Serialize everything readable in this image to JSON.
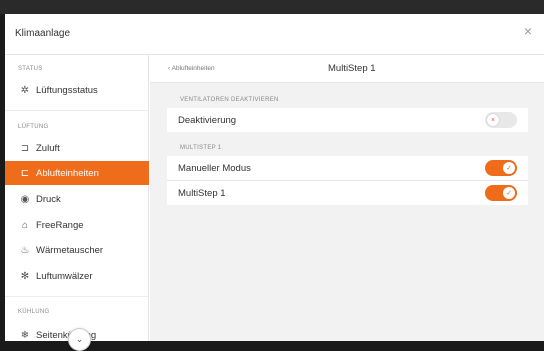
{
  "window": {
    "title": "Klimaanlage"
  },
  "sidebar": {
    "sections": [
      {
        "label": "STATUS"
      },
      {
        "label": "LÜFTUNG"
      },
      {
        "label": "KÜHLUNG"
      }
    ],
    "items": [
      {
        "label": "Lüftungsstatus",
        "icon": "fan-icon",
        "glyph": "✲"
      },
      {
        "label": "Zuluft",
        "icon": "supply-air-icon",
        "glyph": "⊐"
      },
      {
        "label": "Ablufteinheiten",
        "icon": "exhaust-air-icon",
        "glyph": "⊏"
      },
      {
        "label": "Druck",
        "icon": "pressure-icon",
        "glyph": "◉"
      },
      {
        "label": "FreeRange",
        "icon": "freerange-icon",
        "glyph": "⌂"
      },
      {
        "label": "Wärmetauscher",
        "icon": "heat-exchanger-icon",
        "glyph": "♨"
      },
      {
        "label": "Luftumwälzer",
        "icon": "air-circulator-icon",
        "glyph": "✻"
      },
      {
        "label": "Seitenkühlung",
        "icon": "side-cooling-icon",
        "glyph": "❄"
      }
    ]
  },
  "content": {
    "back_label": "Ablufteinheiten",
    "title": "MultiStep 1",
    "groups": [
      {
        "label": "VENTILATOREN DEAKTIVIEREN",
        "rows": [
          {
            "label": "Deaktivierung",
            "state": "off"
          }
        ]
      },
      {
        "label": "MULTISTEP 1",
        "rows": [
          {
            "label": "Manueller Modus",
            "state": "on"
          },
          {
            "label": "MultiStep 1",
            "state": "on"
          }
        ]
      }
    ]
  },
  "colors": {
    "accent": "#ef6c1a",
    "off_mark": "#e05050"
  },
  "glyphs": {
    "close": "×",
    "back": "‹",
    "check": "✓",
    "cross": "×",
    "chevron": "⌄"
  }
}
